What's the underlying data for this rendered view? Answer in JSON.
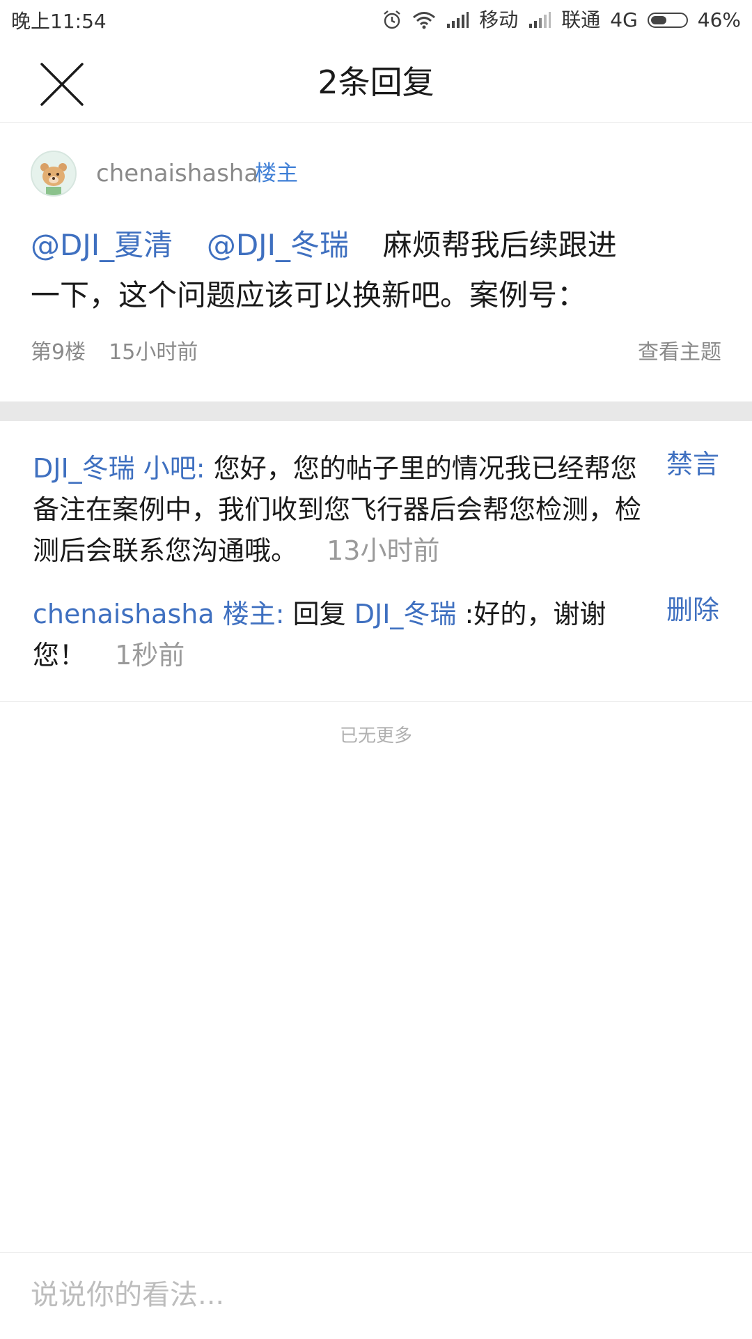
{
  "status_bar": {
    "time": "晚上11:54",
    "carrier1": "移动",
    "carrier2": "联通",
    "network": "4G",
    "battery": "46%",
    "battery_level": 0.46,
    "icons": [
      "alarm-icon",
      "wifi-icon",
      "signal-icon",
      "signal-icon",
      "battery-icon"
    ]
  },
  "header": {
    "close_icon": "close-icon",
    "title": "2条回复"
  },
  "post": {
    "author": "chenaishasha",
    "author_badge": "楼主",
    "mention1": "@DJI_夏清",
    "mention2": "@DJI_冬瑞",
    "content": "麻烦帮我后续跟进一下，这个问题应该可以换新吧。案例号：",
    "floor": "第9楼",
    "time": "15小时前",
    "view_topic": "查看主题"
  },
  "replies": [
    {
      "user": "DJI_冬瑞",
      "badge": "小吧",
      "colon": ":",
      "text": "您好，您的帖子里的情况我已经帮您备注在案例中，我们收到您飞行器后会帮您检测，检测后会联系您沟通哦。",
      "time": "13小时前",
      "action": "禁言"
    },
    {
      "user": "chenaishasha",
      "badge": "楼主",
      "colon": ":",
      "reply_prefix": "回复",
      "reply_to": "DJI_冬瑞",
      "text": ":好的，谢谢您！",
      "time": "1秒前",
      "action": "删除"
    }
  ],
  "footer": {
    "no_more": "已无更多",
    "input_placeholder": "说说你的看法..."
  },
  "colors": {
    "link": "#3f70c0",
    "badge": "#3f7fd6",
    "meta": "#8a8a8a",
    "divider": "#e8e8e8"
  }
}
